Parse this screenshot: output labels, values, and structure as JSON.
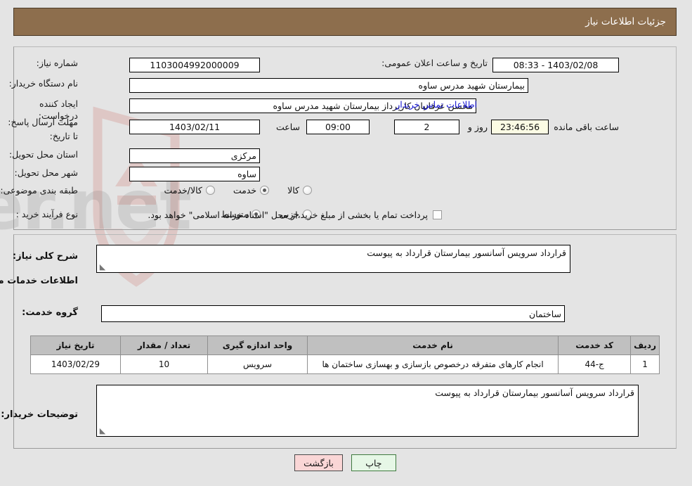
{
  "header": {
    "title": "جزئیات اطلاعات نیاز"
  },
  "top_form": {
    "need_number_label": "شماره نیاز:",
    "need_number_value": "1103004992000009",
    "announce_datetime_label": "تاریخ و ساعت اعلان عمومی:",
    "announce_datetime_value": "1403/02/08 - 08:33",
    "buyer_org_label": "نام دستگاه خریدار:",
    "buyer_org_value": "بیمارستان شهید مدرس ساوه",
    "requester_label": "ایجاد کننده درخواست:",
    "requester_value": "محسن عرفانیان کارپرداز بیمارستان شهید مدرس ساوه",
    "contact_link": "اطلاعات تماس خریدار",
    "deadline_label": "مهلت ارسال پاسخ: تا تاریخ:",
    "deadline_date": "1403/02/11",
    "deadline_hour_label": "ساعت",
    "deadline_hour": "09:00",
    "days_value": "2",
    "days_label": "روز و",
    "timer_value": "23:46:56",
    "timer_label": "ساعت باقی مانده",
    "province_label": "استان محل تحویل:",
    "province_value": "مرکزی",
    "city_label": "شهر محل تحویل:",
    "city_value": "ساوه",
    "category_label": "طبقه بندی موضوعی:",
    "category_options": [
      {
        "label": "کالا",
        "selected": false
      },
      {
        "label": "خدمت",
        "selected": true
      },
      {
        "label": "کالا/خدمت",
        "selected": false
      }
    ],
    "process_label": "نوع فرآیند خرید :",
    "process_options": [
      {
        "label": "جزیی",
        "selected": false
      },
      {
        "label": "متوسط",
        "selected": true
      }
    ],
    "treasury_checkbox_checked": false,
    "treasury_note": "پرداخت تمام یا بخشی از مبلغ خرید،از محل \"اسناد خزانه اسلامی\" خواهد بود."
  },
  "mid": {
    "general_desc_label": "شرح کلی نیاز:",
    "general_desc_value": "قرارداد سرویس آسانسور بیمارستان قرارداد به پیوست",
    "services_section_title": "اطلاعات خدمات مورد نیاز",
    "service_group_label": "گروه خدمت:",
    "service_group_value": "ساختمان",
    "buyer_notes_label": "توضیحات خریدار:",
    "buyer_notes_value": "قرارداد سرویس آسانسور بیمارستان قرارداد به پیوست",
    "resize_grip": "◢"
  },
  "table": {
    "headers": [
      "ردیف",
      "کد خدمت",
      "نام خدمت",
      "واحد اندازه گیری",
      "تعداد / مقدار",
      "تاریخ نیاز"
    ],
    "rows": [
      {
        "index": "1",
        "code": "ج-44",
        "name": "انجام کارهای متفرقه درخصوص بازسازی و بهسازی ساختمان ها",
        "unit": "سرویس",
        "quantity": "10",
        "need_date": "1403/02/29"
      }
    ]
  },
  "buttons": {
    "back_label": "بازگشت",
    "print_label": "چاپ"
  },
  "watermark": {
    "text": "AriaTender.net"
  },
  "colors": {
    "header_bg": "#8d6e4d",
    "page_bg": "#e4e4e4",
    "link": "#1414d2",
    "timer_bg": "#fbfbe4",
    "back_btn_bg": "#fad6d6",
    "print_btn_bg": "#e6f7e6",
    "table_header_bg": "#c0c0c0"
  }
}
